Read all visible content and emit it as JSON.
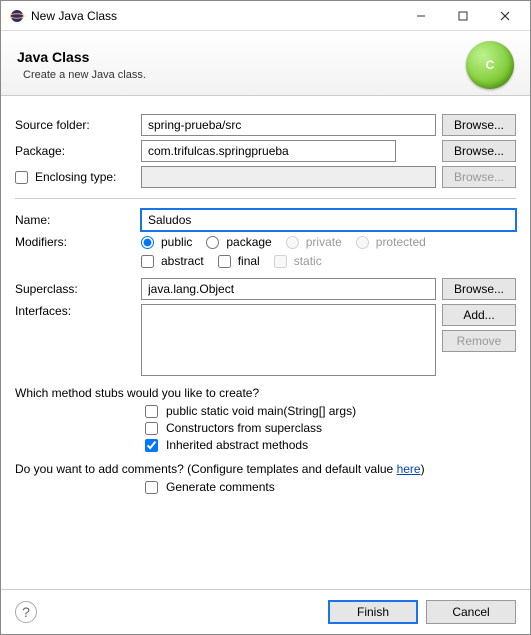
{
  "window": {
    "title": "New Java Class"
  },
  "banner": {
    "heading": "Java Class",
    "sub": "Create a new Java class.",
    "icon_letter": "C"
  },
  "labels": {
    "source_folder": "Source folder:",
    "package": "Package:",
    "enclosing": "Enclosing type:",
    "name": "Name:",
    "modifiers": "Modifiers:",
    "superclass": "Superclass:",
    "interfaces": "Interfaces:",
    "stubs_q": "Which method stubs would you like to create?",
    "comments_q": "Do you want to add comments? (Configure templates and default value ",
    "here": "here",
    "paren": ")"
  },
  "fields": {
    "source_folder": "spring-prueba/src",
    "package": "com.trifulcas.springprueba",
    "enclosing": "",
    "name": "Saludos",
    "superclass": "java.lang.Object"
  },
  "buttons": {
    "browse": "Browse...",
    "add": "Add...",
    "remove": "Remove",
    "finish": "Finish",
    "cancel": "Cancel"
  },
  "modifiers": {
    "public": "public",
    "package": "package",
    "private": "private",
    "protected": "protected",
    "abstract": "abstract",
    "final": "final",
    "static": "static"
  },
  "stubs": {
    "main": "public static void main(String[] args)",
    "constructors": "Constructors from superclass",
    "inherited": "Inherited abstract methods",
    "gen_comments": "Generate comments"
  }
}
